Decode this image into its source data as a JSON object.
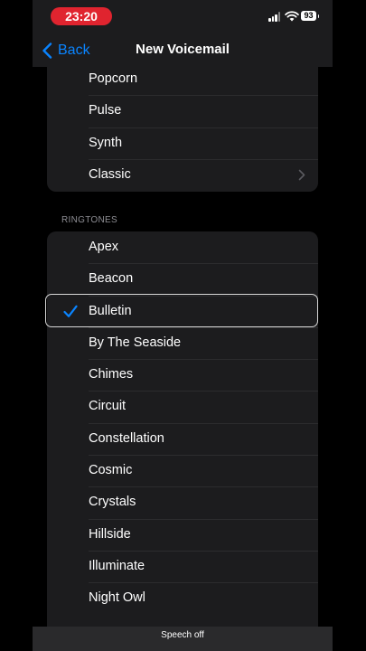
{
  "status": {
    "time": "23:20",
    "battery": "93"
  },
  "nav": {
    "back_label": "Back",
    "title": "New Voicemail"
  },
  "alert_tones": [
    "Popcorn",
    "Pulse",
    "Synth",
    "Classic"
  ],
  "ringtones_header": "RINGTONES",
  "ringtones": [
    "Apex",
    "Beacon",
    "Bulletin",
    "By The Seaside",
    "Chimes",
    "Circuit",
    "Constellation",
    "Cosmic",
    "Crystals",
    "Hillside",
    "Illuminate",
    "Night Owl"
  ],
  "selected_ringtone": "Bulletin",
  "footer": {
    "speech": "Speech off"
  },
  "colors": {
    "accent": "#0a84ff",
    "status_pill": "#e0242f",
    "background": "#000000",
    "cell": "#1c1c1e"
  }
}
